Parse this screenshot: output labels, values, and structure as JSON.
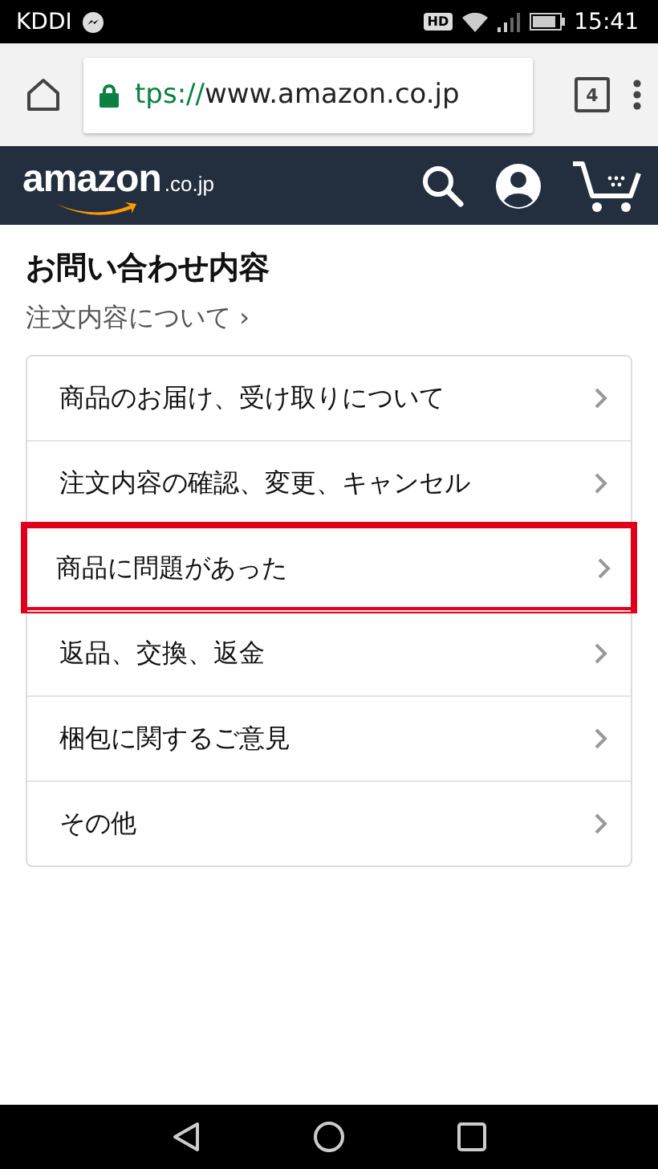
{
  "status_bar": {
    "carrier": "KDDI",
    "hd_badge": "HD",
    "time": "15:41"
  },
  "browser": {
    "url_scheme": "tps://",
    "url_host": "www.amazon.co.jp",
    "tab_count": "4"
  },
  "header": {
    "logo": "amazon",
    "logo_suffix": ".co.jp"
  },
  "page": {
    "title": "お問い合わせ内容",
    "breadcrumb": "注文内容について",
    "breadcrumb_arrow": "›"
  },
  "options": [
    {
      "label": "商品のお届け、受け取りについて",
      "highlighted": false
    },
    {
      "label": "注文内容の確認、変更、キャンセル",
      "highlighted": false
    },
    {
      "label": "商品に問題があった",
      "highlighted": true
    },
    {
      "label": "返品、交換、返金",
      "highlighted": false
    },
    {
      "label": "梱包に関するご意見",
      "highlighted": false
    },
    {
      "label": "その他",
      "highlighted": false
    }
  ]
}
